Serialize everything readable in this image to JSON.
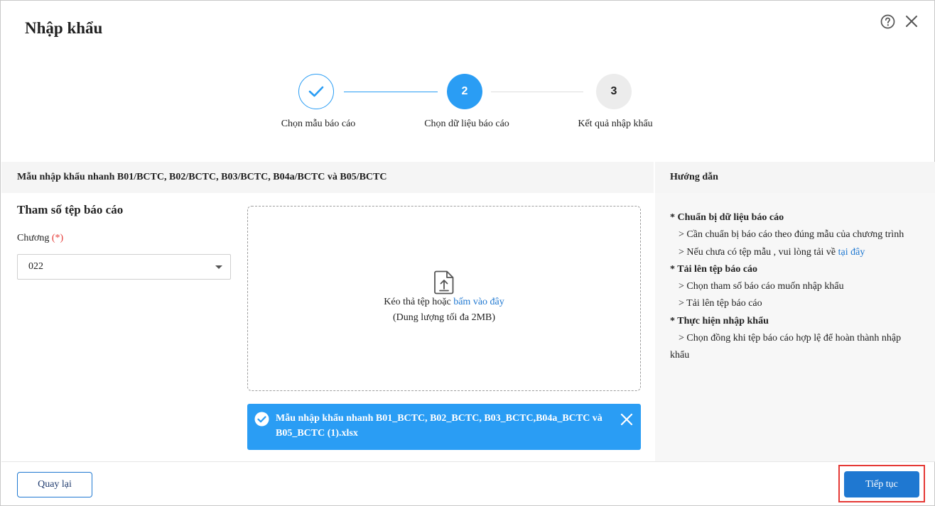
{
  "dialog": {
    "title": "Nhập khẩu"
  },
  "stepper": {
    "steps": [
      {
        "number": "",
        "label": "Chọn mẫu báo cáo",
        "state": "done"
      },
      {
        "number": "2",
        "label": "Chọn dữ liệu báo cáo",
        "state": "active"
      },
      {
        "number": "3",
        "label": "Kết quả nhập khẩu",
        "state": "pending"
      }
    ]
  },
  "section": {
    "left_header": "Mẫu nhập khẩu nhanh B01/BCTC, B02/BCTC, B03/BCTC, B04a/BCTC và B05/BCTC",
    "right_header": "Hướng dẫn"
  },
  "params": {
    "title": "Tham số tệp báo cáo",
    "chuong_label": "Chương",
    "required_mark": "(*)",
    "chuong_value": "022"
  },
  "dropzone": {
    "text_prefix": "Kéo thả tệp hoặc",
    "link_text": "bấm vào đây",
    "size_note": "(Dung lượng tối đa 2MB)"
  },
  "file": {
    "name": "Mẫu nhập khẩu nhanh B01_BCTC, B02_BCTC, B03_BCTC,B04a_BCTC và B05_BCTC (1).xlsx"
  },
  "guide": {
    "sections": [
      {
        "title": "* Chuẩn bị dữ liệu báo cáo"
      },
      {
        "title": "* Tải lên tệp báo cáo"
      },
      {
        "title": "* Thực hiện nhập khẩu"
      }
    ],
    "item_1_1": "> Cần chuẩn bị báo cáo theo đúng mẫu của chương trình",
    "item_1_2_prefix": "> Nếu chưa có tệp mẫu , vui lòng tải về",
    "item_1_2_link": "tại đây",
    "item_2_1": "> Chọn tham số báo cáo muốn nhập khẩu",
    "item_2_2": "> Tải lên tệp báo cáo",
    "item_3_1": "> Chọn đồng khi tệp báo cáo hợp lệ để hoàn thành nhập",
    "item_3_1_cont": "khẩu"
  },
  "footer": {
    "back_label": "Quay lại",
    "next_label": "Tiếp tục"
  },
  "colors": {
    "primary": "#2a9df4",
    "button": "#1f78d1",
    "required": "#e53935",
    "highlight": "#e53935"
  },
  "icons": {
    "help": "help-circle-icon",
    "close": "close-icon",
    "step_done": "check-icon",
    "upload": "file-upload-icon",
    "file_ok": "check-circle-icon",
    "file_remove": "close-icon",
    "select": "chevron-down-icon"
  }
}
